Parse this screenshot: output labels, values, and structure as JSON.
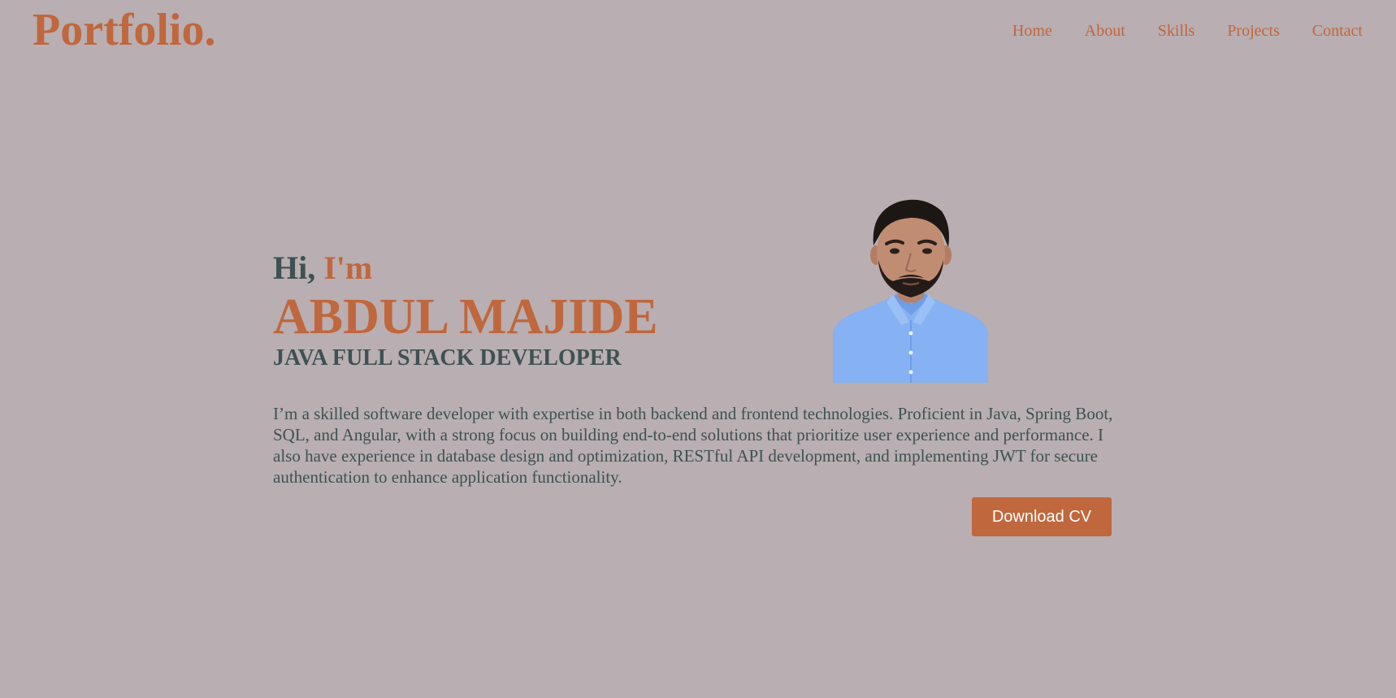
{
  "brand": {
    "logo": "Portfolio."
  },
  "nav": {
    "items": [
      {
        "label": "Home"
      },
      {
        "label": "About"
      },
      {
        "label": "Skills"
      },
      {
        "label": "Projects"
      },
      {
        "label": "Contact"
      }
    ]
  },
  "hero": {
    "greeting_hi": "Hi,",
    "greeting_im": "I'm",
    "name": "ABDUL MAJIDE",
    "role": "JAVA FULL STACK DEVELOPER",
    "bio": "I’m a skilled software developer with expertise in both backend and frontend technologies. Proficient in Java, Spring Boot, SQL, and Angular, with a strong focus on building end-to-end solutions that prioritize user experience and performance. I also have experience in database design and optimization, RESTful API development, and implementing JWT for secure authentication to enhance application functionality.",
    "download_label": "Download CV"
  },
  "colors": {
    "background": "#b9aeb1",
    "accent": "#c0673d",
    "text_dark": "#3e5153",
    "shirt": "#86b1f2"
  }
}
